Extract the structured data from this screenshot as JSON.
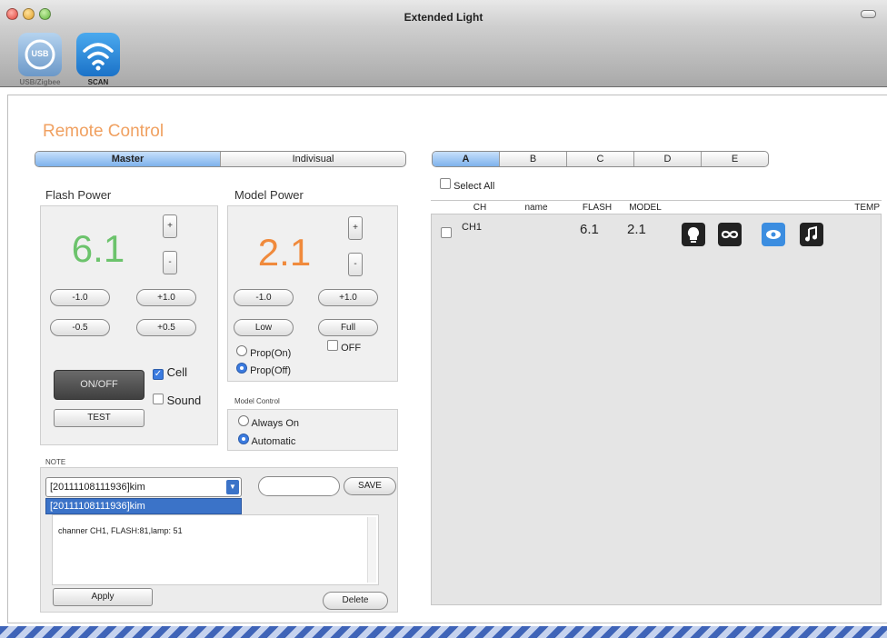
{
  "window": {
    "title": "Extended Light"
  },
  "toolbar": {
    "usb_label": "USB/Zigbee",
    "usb_icon_text": "USB",
    "scan_label": "SCAN"
  },
  "remote": {
    "title": "Remote Control",
    "tabs": [
      "Master",
      "Indivisual"
    ]
  },
  "flash": {
    "heading": "Flash Power",
    "value": "6.1",
    "plus": "+",
    "minus": "-",
    "minus1": "-1.0",
    "plus1": "+1.0",
    "minus05": "-0.5",
    "plus05": "+0.5"
  },
  "model": {
    "heading": "Model Power",
    "value": "2.1",
    "plus": "+",
    "minus": "-",
    "minus1": "-1.0",
    "plus1": "+1.0",
    "low": "Low",
    "full": "Full",
    "prop_on": "Prop(On)",
    "off": "OFF",
    "prop_off": "Prop(Off)"
  },
  "controls": {
    "onoff": "ON/OFF",
    "cell": "Cell",
    "sound": "Sound",
    "test": "TEST"
  },
  "model_control": {
    "heading": "Model Control",
    "always_on": "Always On",
    "automatic": "Automatic"
  },
  "note": {
    "heading": "NOTE",
    "select_value": "[20111108111936]kim",
    "dropdown_option": "[20111108111936]kim",
    "save": "SAVE",
    "text": "channer CH1, FLASH:81,lamp: 51",
    "apply": "Apply",
    "delete": "Delete"
  },
  "groups": {
    "tabs": [
      "A",
      "B",
      "C",
      "D",
      "E"
    ],
    "select_all": "Select All"
  },
  "table": {
    "columns": [
      "CH",
      "name",
      "FLASH",
      "MODEL",
      "TEMP"
    ],
    "rows": [
      {
        "ch": "CH1",
        "name": "",
        "flash": "6.1",
        "model": "2.1"
      }
    ]
  },
  "colors": {
    "flash_value": "#6cc36c",
    "model_value": "#f08a3c",
    "title_accent": "#f0a060",
    "selection": "#3b73c8"
  }
}
